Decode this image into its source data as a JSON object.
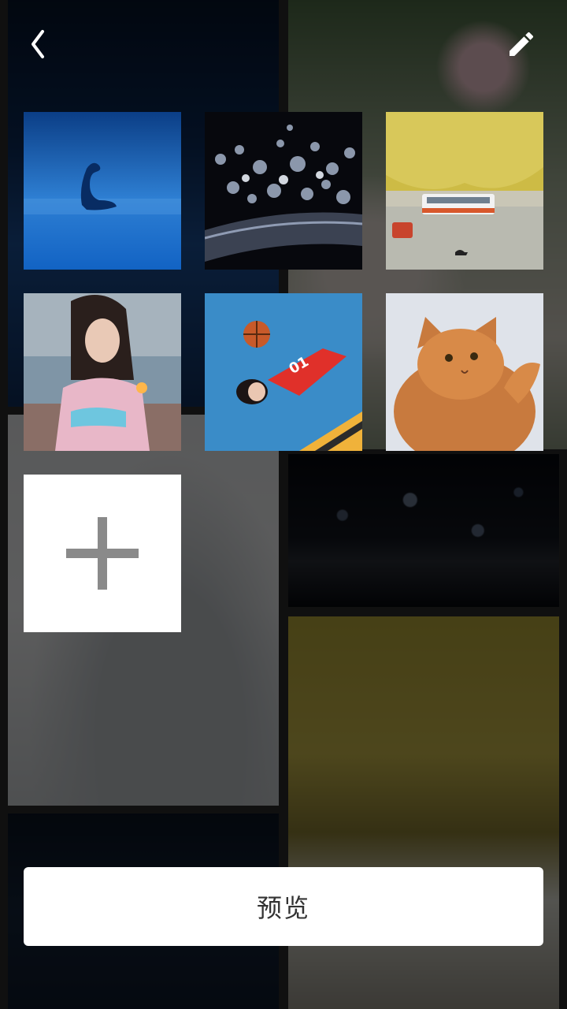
{
  "topbar": {
    "back_icon": "chevron-left-icon",
    "edit_icon": "pencil-icon"
  },
  "photos": [
    {
      "subject": "swan"
    },
    {
      "subject": "bokeh-lights"
    },
    {
      "subject": "tree-lined-street"
    },
    {
      "subject": "girl-with-sparkler"
    },
    {
      "subject": "girl-with-basketball"
    },
    {
      "subject": "orange-cat"
    }
  ],
  "add_button": {
    "icon": "plus-icon"
  },
  "preview_button": {
    "label": "预览"
  },
  "colors": {
    "overlay": "#000000",
    "button_bg": "#ffffff",
    "button_text": "#333333",
    "plus": "#8a8a8a"
  }
}
